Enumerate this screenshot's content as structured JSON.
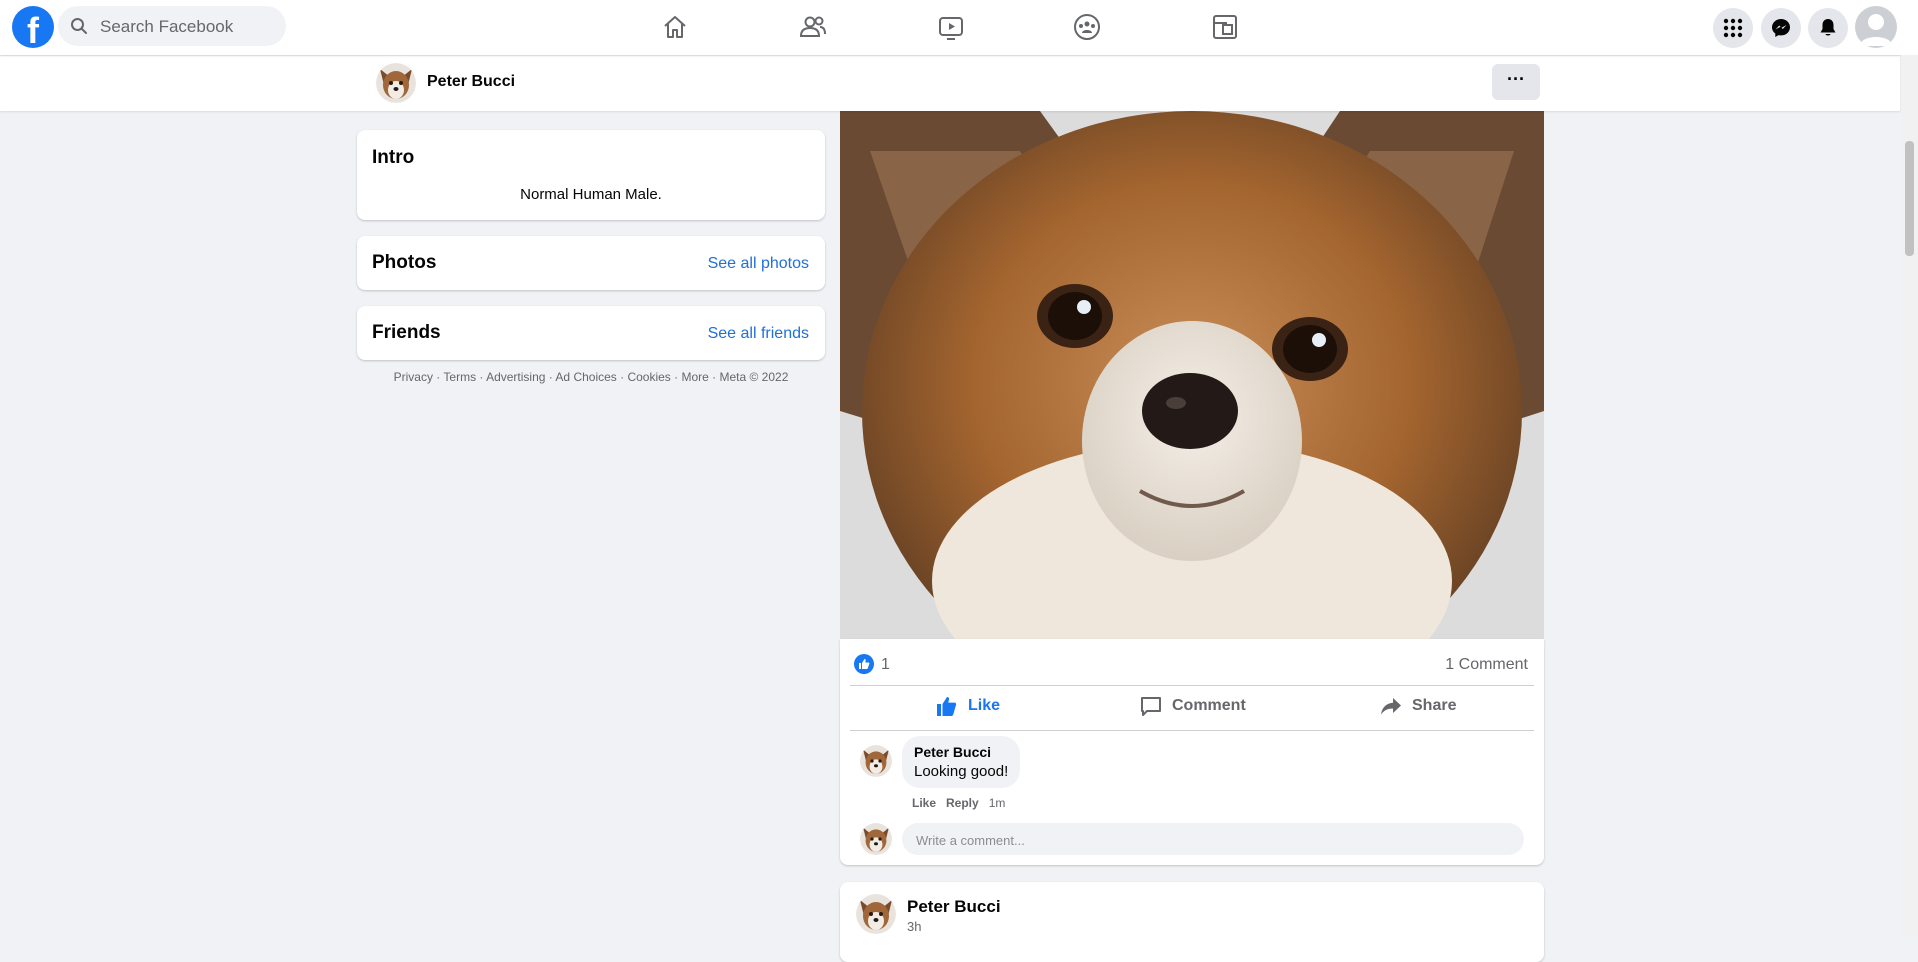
{
  "topbar": {
    "search_placeholder": "Search Facebook",
    "logo_letter": "f",
    "nav_icons": [
      "home-icon",
      "friends-icon",
      "watch-icon",
      "groups-icon",
      "gaming-icon"
    ],
    "right_icons": [
      "menu-grid-icon",
      "messenger-icon",
      "notifications-icon",
      "account-avatar"
    ]
  },
  "profile": {
    "name": "Peter Bucci",
    "more_label": "···"
  },
  "intro": {
    "title": "Intro",
    "bio": "Normal Human Male."
  },
  "photos": {
    "title": "Photos",
    "link": "See all photos"
  },
  "friends": {
    "title": "Friends",
    "link": "See all friends"
  },
  "footer": {
    "text": "Privacy · Terms · Advertising · Ad Choices · Cookies · More · Meta © 2022"
  },
  "post": {
    "like_count": "1",
    "comment_count": "1 Comment",
    "actions": {
      "like": "Like",
      "comment": "Comment",
      "share": "Share"
    },
    "comment": {
      "author": "Peter Bucci",
      "text": "Looking good!",
      "like": "Like",
      "reply": "Reply",
      "time": "1m"
    },
    "comment_placeholder": "Write a comment..."
  },
  "next_post": {
    "author": "Peter Bucci",
    "time": "3h"
  },
  "colors": {
    "brand": "#1877f2",
    "link": "#216fdb",
    "background": "#f0f2f5"
  }
}
